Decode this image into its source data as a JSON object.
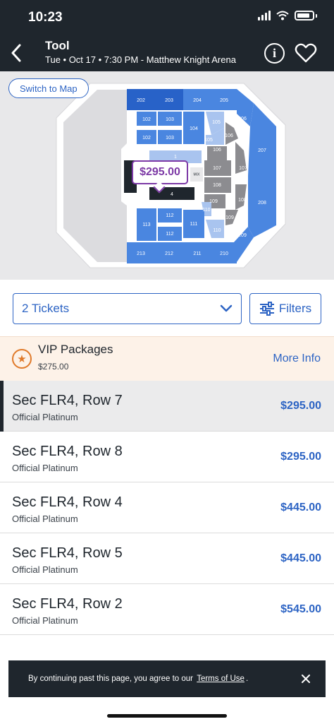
{
  "status": {
    "time": "10:23"
  },
  "header": {
    "title": "Tool",
    "subtitle": "Tue • Oct 17 • 7:30 PM - Matthew Knight Arena",
    "icons": [
      "chevron-left-icon",
      "info-icon",
      "heart-icon"
    ]
  },
  "map": {
    "switch_label": "Switch to Map",
    "price_bubble": "$295.00",
    "sections": {
      "s202": "202",
      "s203": "203",
      "s204": "204",
      "s205": "205",
      "s206": "206",
      "s207": "207",
      "s208": "208",
      "s209": "209",
      "s210": "210",
      "s211": "211",
      "s212": "212",
      "s213": "213",
      "s102a": "102",
      "s103a": "103",
      "s102b": "102",
      "s103b": "103",
      "s104": "104",
      "s105a": "105",
      "s105b": "105",
      "s106a": "106",
      "s106b": "106",
      "s107a": "107",
      "s107b": "107",
      "s108a": "108",
      "s108b": "108",
      "s109a": "109",
      "s109b": "109",
      "s110a": "110",
      "s110b": "110",
      "s111": "111",
      "s112a": "112",
      "s112b": "112",
      "s113": "113",
      "s1": "1",
      "s4": "4",
      "mix": "MIX"
    },
    "colors": {
      "section_blue": "#4a86e0",
      "section_dark_blue": "#2862c8",
      "section_light": "#a9c4ef",
      "section_grey": "#8c8c90",
      "floor_selected": "#1f262d",
      "bubble": "#7d3aa6"
    }
  },
  "controls": {
    "tickets_label": "2 Tickets",
    "filters_label": "Filters"
  },
  "vip": {
    "title": "VIP Packages",
    "price": "$275.00",
    "more_info": "More Info"
  },
  "listings": [
    {
      "title": "Sec FLR4, Row 7",
      "sub": "Official Platinum",
      "price": "$295.00"
    },
    {
      "title": "Sec FLR4, Row 8",
      "sub": "Official Platinum",
      "price": "$295.00"
    },
    {
      "title": "Sec FLR4, Row 4",
      "sub": "Official Platinum",
      "price": "$445.00"
    },
    {
      "title": "Sec FLR4, Row 5",
      "sub": "Official Platinum",
      "price": "$445.00"
    },
    {
      "title": "Sec FLR4, Row 2",
      "sub": "Official Platinum",
      "price": "$545.00"
    }
  ],
  "cookie": {
    "text_before": "By continuing past this page, you agree to our",
    "link": "Terms of Use",
    "text_after": "."
  }
}
